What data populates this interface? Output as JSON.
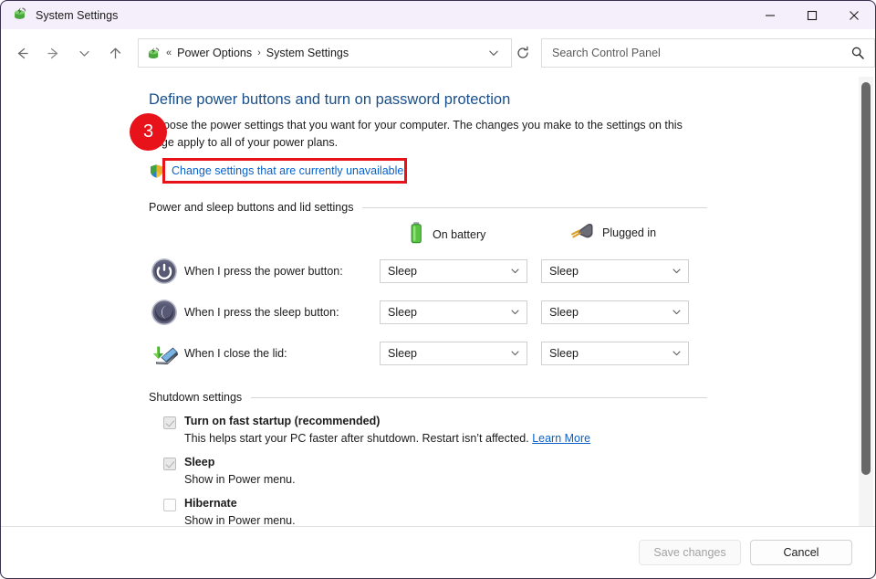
{
  "window": {
    "title": "System Settings",
    "app_icon": "power-options-icon",
    "controls": {
      "minimize": "minimize-button",
      "maximize": "maximize-button",
      "close": "close-button"
    }
  },
  "toolbar": {
    "back": "back-arrow-icon",
    "forward": "forward-arrow-icon",
    "recent": "recent-locations-chevron-icon",
    "up": "up-arrow-icon",
    "address": {
      "icon": "power-options-icon",
      "separator_first": "«",
      "crumbs": [
        "Power Options",
        "System Settings"
      ],
      "crumb_separator": "›",
      "dropdown": "address-dropdown-icon",
      "refresh": "refresh-icon"
    },
    "search": {
      "placeholder": "Search Control Panel",
      "value": "",
      "icon": "search-icon"
    }
  },
  "content": {
    "page_title": "Define power buttons and turn on password protection",
    "intro": "Choose the power settings that you want for your computer. The changes you make to the settings on this page apply to all of your power plans.",
    "unavailable_link": "Change settings that are currently unavailable",
    "shield_icon": "uac-shield-icon",
    "badge": "3",
    "groups": {
      "power_lid": "Power and sleep buttons and lid settings",
      "shutdown": "Shutdown settings"
    },
    "columns": [
      {
        "label": "On battery",
        "icon": "battery-icon"
      },
      {
        "label": "Plugged in",
        "icon": "power-plug-icon"
      }
    ],
    "rows": [
      {
        "icon": "power-button-icon",
        "label": "When I press the power button:",
        "on_battery": "Sleep",
        "plugged_in": "Sleep"
      },
      {
        "icon": "sleep-button-icon",
        "label": "When I press the sleep button:",
        "on_battery": "Sleep",
        "plugged_in": "Sleep"
      },
      {
        "icon": "laptop-lid-icon",
        "label": "When I close the lid:",
        "on_battery": "Sleep",
        "plugged_in": "Sleep"
      }
    ],
    "shutdown_options": [
      {
        "label": "Turn on fast startup (recommended)",
        "checked": true,
        "description": "This helps start your PC faster after shutdown. Restart isn’t affected.",
        "link": "Learn More"
      },
      {
        "label": "Sleep",
        "checked": true,
        "description": "Show in Power menu.",
        "link": ""
      },
      {
        "label": "Hibernate",
        "checked": false,
        "description": "Show in Power menu.",
        "link": ""
      }
    ]
  },
  "footer": {
    "save_label": "Save changes",
    "cancel_label": "Cancel"
  },
  "colors": {
    "accent_link": "#0a61c9",
    "title_heading": "#1a4f8a",
    "highlight_red": "#e8121a",
    "titlebar_bg": "#f4effa"
  }
}
